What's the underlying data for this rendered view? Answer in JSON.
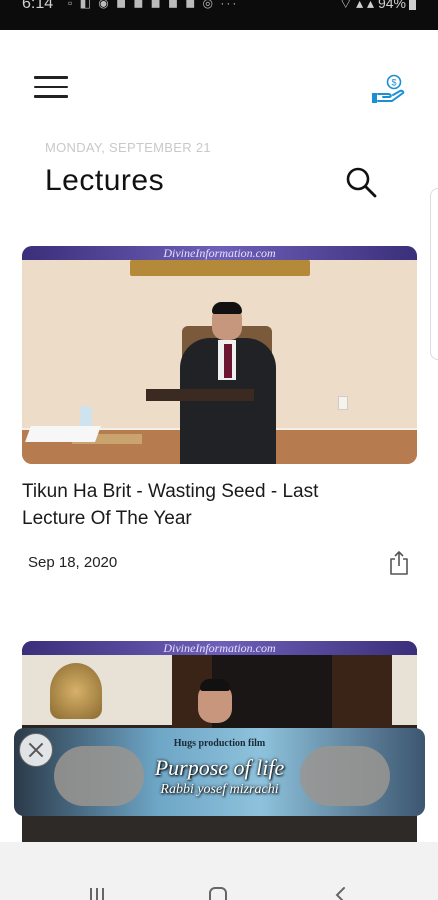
{
  "status_bar": {
    "time": "6:14",
    "notification_icons": "▫ ◧ ◉ ◼ ◼ ◼ ◼ ◼ ◎ ···",
    "signal": "⌔ ▴ ▴",
    "battery": "94%"
  },
  "header": {
    "date": "MONDAY, SEPTEMBER 21",
    "title": "Lectures"
  },
  "thumbnail_banner": "DivineInformation.com",
  "lectures": [
    {
      "title": "Tikun Ha Brit - Wasting Seed - Last Lecture Of The Year",
      "date": "Sep 18, 2020"
    }
  ],
  "ad": {
    "tagline": "Hugs production film",
    "title": "Purpose of life",
    "subtitle": "Rabbi yosef mizrachi",
    "close": "×"
  },
  "colors": {
    "accent_blue": "#1a8fd6",
    "status_bar_bg": "#0c0c0c",
    "nav_bar_bg": "#f2f2f2"
  },
  "icons": {
    "menu": "hamburger-menu-icon",
    "donate": "hand-coin-icon",
    "search": "search-icon",
    "share": "share-icon",
    "close": "close-icon"
  }
}
